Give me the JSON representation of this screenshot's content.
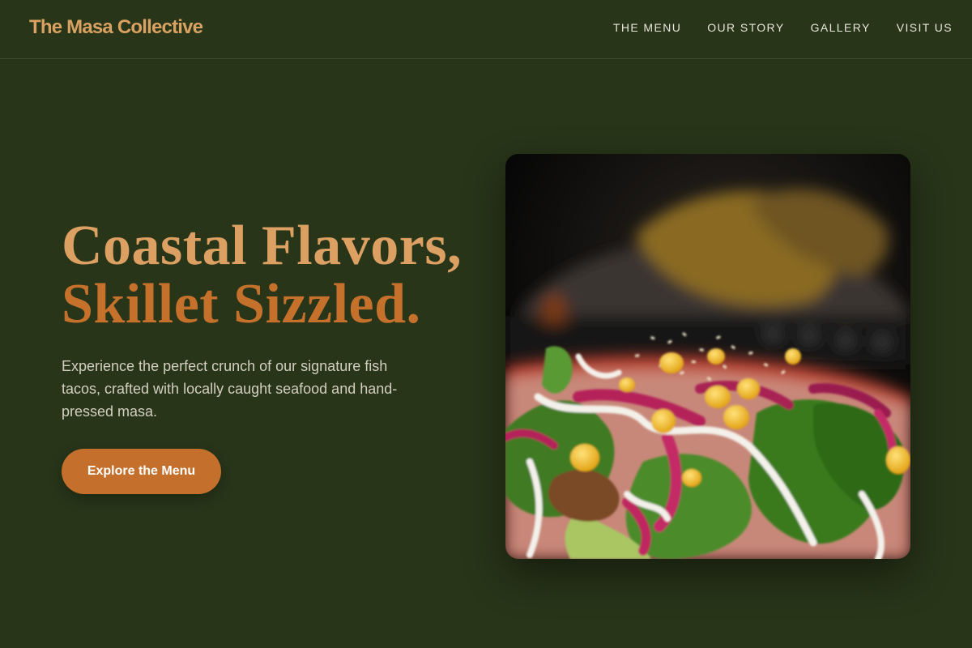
{
  "header": {
    "brand": "The Masa Collective",
    "nav": [
      {
        "label": "THE MENU"
      },
      {
        "label": "OUR STORY"
      },
      {
        "label": "GALLERY"
      },
      {
        "label": "VISIT US"
      }
    ]
  },
  "hero": {
    "title_line1": "Coastal Flavors,",
    "title_line2": "Skillet Sizzled.",
    "description": "Experience the perfect crunch of our signature fish tacos, crafted with locally caught seafood and hand-pressed masa.",
    "cta_label": "Explore the Menu",
    "image_alt": "Close-up of a fish taco topped with corn, pickled red onion, lettuce and cream sauce"
  },
  "colors": {
    "background": "#283519",
    "brand": "#d9a262",
    "accent": "#c4702c",
    "nav_text": "#e9e6dc"
  }
}
